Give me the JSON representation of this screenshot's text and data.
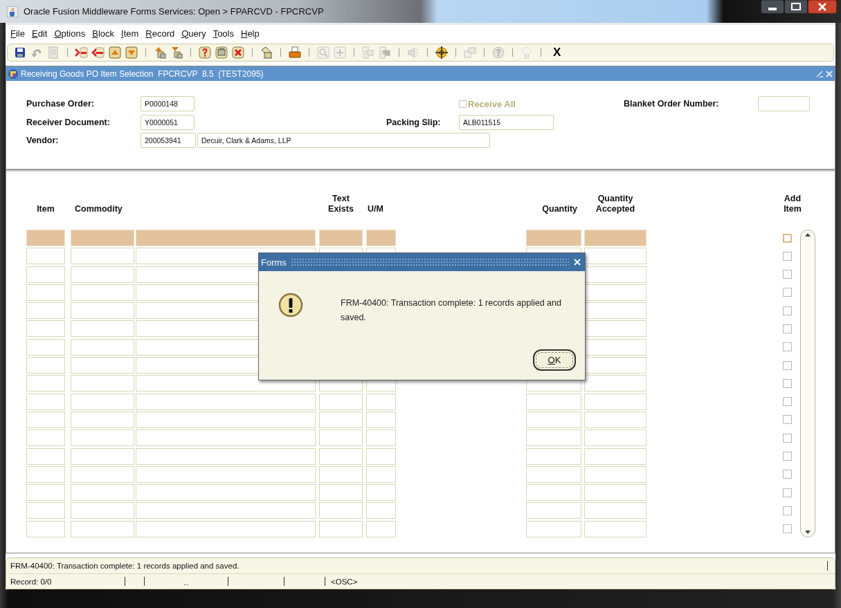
{
  "window": {
    "title": "Oracle Fusion Middleware Forms Services:  Open > FPARCVD - FPCRCVP"
  },
  "menu": [
    {
      "label": "File"
    },
    {
      "label": "Edit"
    },
    {
      "label": "Options"
    },
    {
      "label": "Block"
    },
    {
      "label": "Item"
    },
    {
      "label": "Record"
    },
    {
      "label": "Query"
    },
    {
      "label": "Tools"
    },
    {
      "label": "Help"
    }
  ],
  "toolbar": {
    "buttons": [
      {
        "disabled": false
      },
      {
        "disabled": true
      },
      {
        "disabled": true
      },
      {
        "disabled": false
      },
      {
        "disabled": false
      },
      {
        "disabled": false
      },
      {
        "disabled": false
      },
      {
        "disabled": false
      },
      {
        "disabled": false
      },
      {
        "disabled": false
      },
      {
        "disabled": false
      },
      {
        "disabled": false
      },
      {
        "disabled": false
      },
      {
        "disabled": false
      },
      {
        "disabled": true
      },
      {
        "disabled": true
      },
      {
        "disabled": true
      },
      {
        "disabled": true
      },
      {
        "disabled": true
      },
      {
        "disabled": false
      },
      {
        "disabled": true
      },
      {
        "disabled": true
      },
      {
        "disabled": true
      }
    ],
    "exit_label": "X"
  },
  "form": {
    "title": "Receiving Goods PO Item Selection  FPCRCVP  8.5  (TEST2095)",
    "header": {
      "purchase_order": {
        "label": "Purchase Order:",
        "value": "P0000148"
      },
      "receive_all": {
        "label": "Receive All",
        "checked": false,
        "disabled": true
      },
      "blanket_order_number": {
        "label": "Blanket Order Number:"
      },
      "receiver_document": {
        "label": "Receiver Document:",
        "value": "Y0000051"
      },
      "packing_slip": {
        "label": "Packing Slip:",
        "value": "ALB011515"
      },
      "vendor": {
        "label": "Vendor:",
        "value": "200053941",
        "name": "Decuir, Clark & Adams, LLP"
      }
    },
    "table": {
      "columns": {
        "item": "Item",
        "commodity": "Commodity",
        "text_exists": "Text Exists",
        "um": "U/M",
        "quantity": "Quantity",
        "quantity_accepted": "Quantity Accepted",
        "add_item": "Add Item"
      },
      "rows": [
        {
          "selected": true,
          "add_item": false
        },
        {
          "selected": false,
          "add_item": false
        },
        {
          "selected": false,
          "add_item": false
        },
        {
          "selected": false,
          "add_item": false
        },
        {
          "selected": false,
          "add_item": false
        },
        {
          "selected": false,
          "add_item": false
        },
        {
          "selected": false,
          "add_item": false
        },
        {
          "selected": false,
          "add_item": false
        },
        {
          "selected": false,
          "add_item": false
        },
        {
          "selected": false,
          "add_item": false
        },
        {
          "selected": false,
          "add_item": false
        },
        {
          "selected": false,
          "add_item": false
        },
        {
          "selected": false,
          "add_item": false
        },
        {
          "selected": false,
          "add_item": false
        },
        {
          "selected": false,
          "add_item": false
        },
        {
          "selected": false,
          "add_item": false
        },
        {
          "selected": false,
          "add_item": false
        }
      ]
    }
  },
  "dialog": {
    "title": "Forms",
    "message": "FRM-40400: Transaction complete: 1 records applied and saved.",
    "button": "OK"
  },
  "status_bar": {
    "message": "FRM-40400: Transaction complete: 1 records applied and saved.",
    "record": "Record: 0/0",
    "indicator": "...",
    "mode": "<OSC>"
  }
}
